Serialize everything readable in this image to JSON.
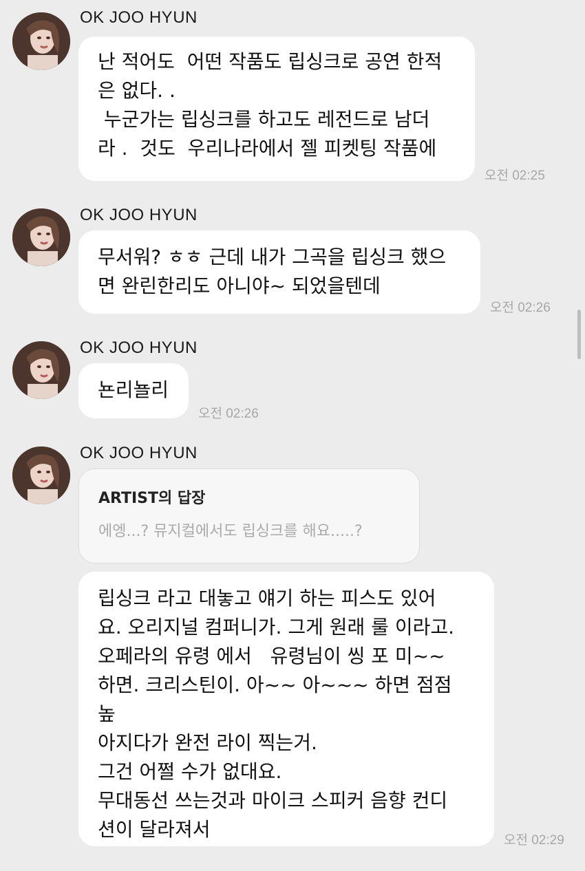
{
  "messages": [
    {
      "sender": "OK JOO HYUN",
      "text": "난 적어도  어떤 작품도 립싱크로 공연 한적\n은 없다. .\n 누군가는 립싱크를 하고도 레전드로 남더\n라 .  것도  우리나라에서 젤 피켓팅 작품에",
      "time": "오전 02:25"
    },
    {
      "sender": "OK JOO HYUN",
      "text": "무서워? ㅎㅎ 근데 내가 그곡을 립싱크 했으\n면 완린한리도 아니야~ 되었을텐데",
      "time": "오전 02:26"
    },
    {
      "sender": "OK JOO HYUN",
      "text": "뇬리뇰리",
      "time": "오전 02:26"
    },
    {
      "sender": "OK JOO HYUN",
      "reply": {
        "title": "ARTIST의 답장",
        "text": "에엥...? 뮤지컬에서도 립싱크를 해요.....?"
      },
      "text": "립싱크 라고 대놓고 얘기 하는 피스도 있어\n요. 오리지널 컴퍼니가. 그게 원래 룰 이라고.\n오페라의 유령 에서   유령님이 씽 포 미~~\n하면. 크리스틴이. 아~~ 아~~~ 하면 점점 높\n아지다가 완전 라이 찍는거.\n그건 어쩔 수가 없대요.\n무대동선 쓰는것과 마이크 스피커 음향 컨디\n션이 달라져서",
      "time": "오전 02:29"
    }
  ]
}
